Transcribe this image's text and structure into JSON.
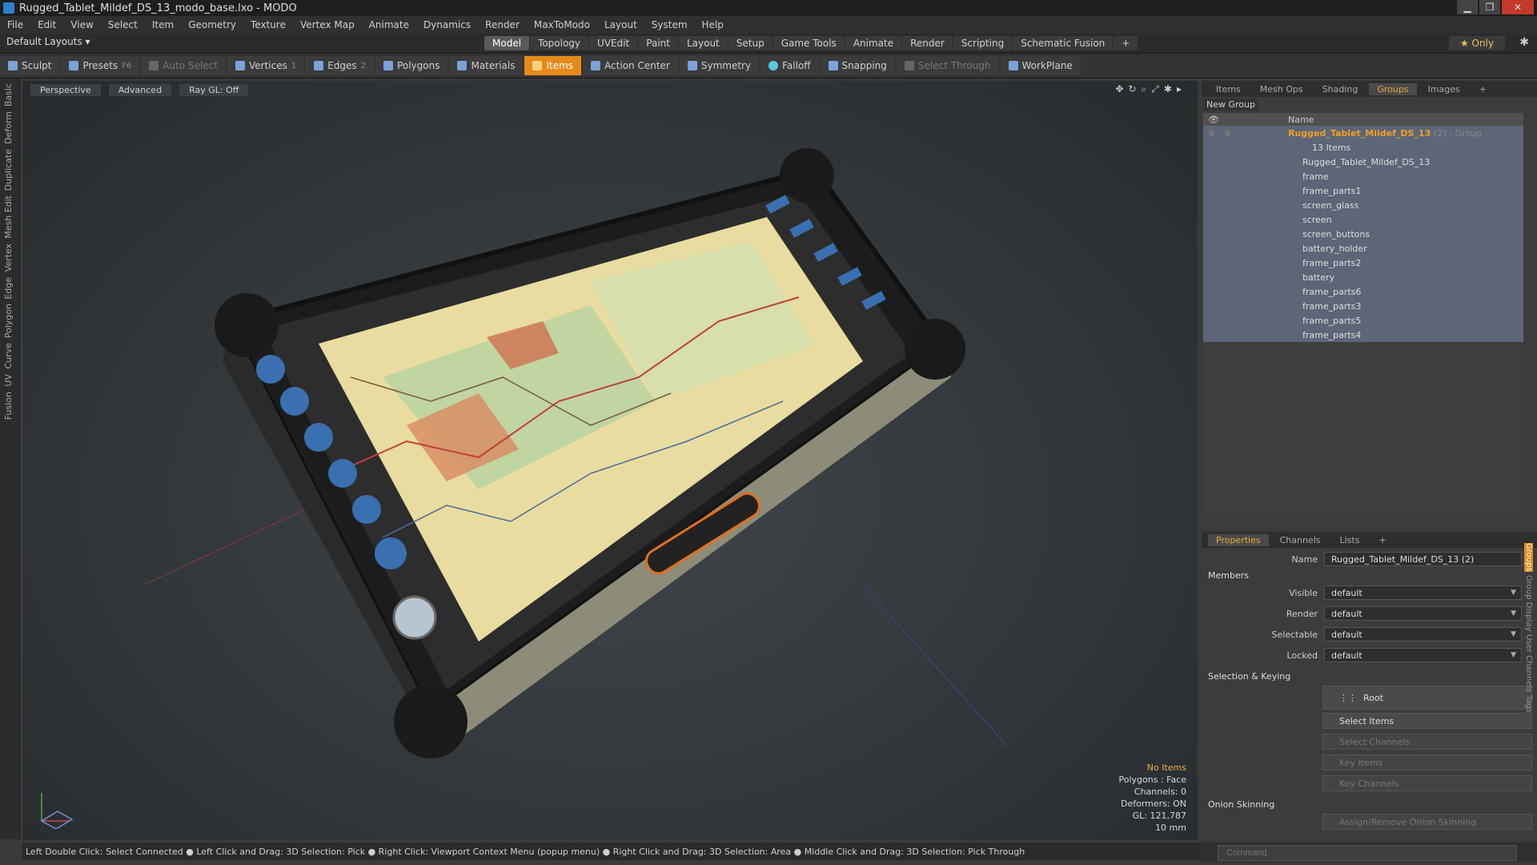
{
  "window": {
    "title": "Rugged_Tablet_Mildef_DS_13_modo_base.lxo - MODO",
    "min": "▁",
    "max": "❐",
    "close": "✕"
  },
  "menu": [
    "File",
    "Edit",
    "View",
    "Select",
    "Item",
    "Geometry",
    "Texture",
    "Vertex Map",
    "Animate",
    "Dynamics",
    "Render",
    "MaxToModo",
    "Layout",
    "System",
    "Help"
  ],
  "layoutbar": {
    "default_layouts": "Default Layouts ▾",
    "tabs": [
      "Model",
      "Topology",
      "UVEdit",
      "Paint",
      "Layout",
      "Setup",
      "Game Tools",
      "Animate",
      "Render",
      "Scripting",
      "Schematic Fusion",
      "+"
    ],
    "active": "Model",
    "only": "★  Only",
    "gear": "✱"
  },
  "toolbar": {
    "sculpt": "Sculpt",
    "presets": "Presets",
    "presets_key": "F6",
    "auto_select": "Auto Select",
    "vertices": "Vertices",
    "vertices_key": "1",
    "edges": "Edges",
    "edges_key": "2",
    "polygons": "Polygons",
    "materials": "Materials",
    "items": "Items",
    "action_center": "Action Center",
    "symmetry": "Symmetry",
    "falloff": "Falloff",
    "snapping": "Snapping",
    "select_through": "Select Through",
    "workplane": "WorkPlane"
  },
  "leftstrip": [
    "Basic",
    "Deform",
    "Duplicate",
    "Mesh Edit",
    "Vertex",
    "Edge",
    "Polygon",
    "Curve",
    "UV",
    "Fusion"
  ],
  "viewport": {
    "perspective": "Perspective",
    "advanced": "Advanced",
    "raygl": "Ray GL: Off",
    "info": {
      "no_items": "No Items",
      "polygons": "Polygons : Face",
      "channels": "Channels: 0",
      "deformers": "Deformers: ON",
      "gl": "GL: 121,787",
      "scale": "10 mm"
    },
    "axis": "ground-axis"
  },
  "statusbar": "Left Double Click: Select Connected ● Left Click and Drag: 3D Selection: Pick ● Right Click: Viewport Context Menu (popup menu) ● Right Click and Drag: 3D Selection: Area ● Middle Click and Drag: 3D Selection: Pick Through",
  "groups_panel": {
    "tabs": [
      "Items",
      "Mesh Ops",
      "Shading",
      "Groups",
      "Images",
      "+"
    ],
    "active": "Groups",
    "new_group": "New Group",
    "header": "Name",
    "root_name": "Rugged_Tablet_Mildef_DS_13",
    "root_sub": "(2) : Group",
    "root_count": "13 Items",
    "items": [
      "Rugged_Tablet_Mildef_DS_13",
      "frame",
      "frame_parts1",
      "screen_glass",
      "screen",
      "screen_buttons",
      "battery_holder",
      "frame_parts2",
      "battery",
      "frame_parts6",
      "frame_parts3",
      "frame_parts5",
      "frame_parts4"
    ]
  },
  "properties": {
    "tabs": [
      "Properties",
      "Channels",
      "Lists",
      "+"
    ],
    "active": "Properties",
    "name_label": "Name",
    "name_value": "Rugged_Tablet_Mildef_DS_13 (2)",
    "members": "Members",
    "visible_label": "Visible",
    "visible": "default",
    "render_label": "Render",
    "render": "default",
    "selectable_label": "Selectable",
    "selectable": "default",
    "locked_label": "Locked",
    "locked": "default",
    "selection_keying": "Selection & Keying",
    "root": "Root",
    "select_items": "Select Items",
    "select_channels": "Select Channels",
    "key_items": "Key Items",
    "key_channels": "Key Channels",
    "onion": "Onion Skinning",
    "assign_onion": "Assign/Remove Onion Skinning",
    "sidetabs": [
      "Groups",
      "Group Display",
      "User Channels",
      "Tags"
    ]
  },
  "command": {
    "placeholder": "Command"
  },
  "colors": {
    "accent": "#e58a1a",
    "selection": "#5d6678",
    "group_title": "#f0a020"
  }
}
